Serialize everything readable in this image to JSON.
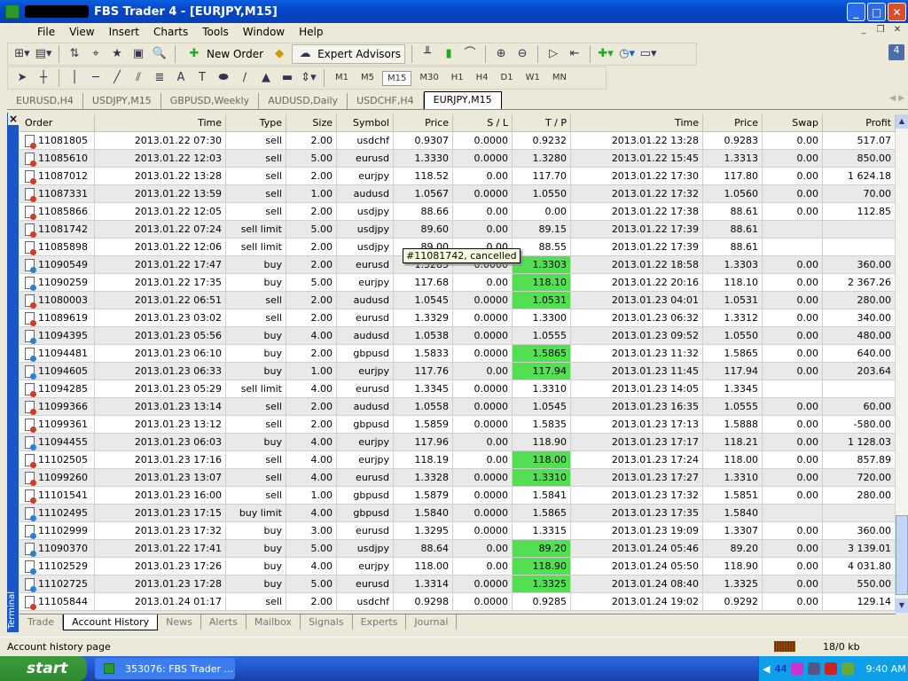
{
  "window": {
    "title": "FBS Trader 4 - [EURJPY,M15]",
    "minimize": "_",
    "maximize": "□",
    "close": "✕"
  },
  "menu": [
    "File",
    "View",
    "Insert",
    "Charts",
    "Tools",
    "Window",
    "Help"
  ],
  "toolbar": {
    "new_order": "New Order",
    "expert_advisors": "Expert Advisors",
    "badge": "4"
  },
  "timeframes": [
    "M1",
    "M5",
    "M15",
    "M30",
    "H1",
    "H4",
    "D1",
    "W1",
    "MN"
  ],
  "active_timeframe": "M15",
  "chart_tabs": [
    "EURUSD,H4",
    "USDJPY,M15",
    "GBPUSD,Weekly",
    "AUDUSD,Daily",
    "USDCHF,H4",
    "EURJPY,M15"
  ],
  "active_chart_tab": "EURJPY,M15",
  "terminal": {
    "label": "Terminal",
    "close": "×",
    "columns": [
      "Order",
      "Time",
      "Type",
      "Size",
      "Symbol",
      "Price",
      "S / L",
      "T / P",
      "Time",
      "Price",
      "Swap",
      "Profit"
    ],
    "sort_indicator": "/",
    "rows": [
      [
        "11081805",
        "2013.01.22 07:30",
        "sell",
        "2.00",
        "usdchf",
        "0.9307",
        "0.0000",
        "0.9232",
        "2013.01.22 13:28",
        "0.9283",
        "0.00",
        "517.07",
        false
      ],
      [
        "11085610",
        "2013.01.22 12:03",
        "sell",
        "5.00",
        "eurusd",
        "1.3330",
        "0.0000",
        "1.3280",
        "2013.01.22 15:45",
        "1.3313",
        "0.00",
        "850.00",
        false
      ],
      [
        "11087012",
        "2013.01.22 13:28",
        "sell",
        "2.00",
        "eurjpy",
        "118.52",
        "0.00",
        "117.70",
        "2013.01.22 17:30",
        "117.80",
        "0.00",
        "1 624.18",
        false
      ],
      [
        "11087331",
        "2013.01.22 13:59",
        "sell",
        "1.00",
        "audusd",
        "1.0567",
        "0.0000",
        "1.0550",
        "2013.01.22 17:32",
        "1.0560",
        "0.00",
        "70.00",
        false
      ],
      [
        "11085866",
        "2013.01.22 12:05",
        "sell",
        "2.00",
        "usdjpy",
        "88.66",
        "0.00",
        "0.00",
        "2013.01.22 17:38",
        "88.61",
        "0.00",
        "112.85",
        false
      ],
      [
        "11081742",
        "2013.01.22 07:24",
        "sell limit",
        "5.00",
        "usdjpy",
        "89.60",
        "0.00",
        "89.15",
        "2013.01.22 17:39",
        "88.61",
        "",
        "",
        false
      ],
      [
        "11085898",
        "2013.01.22 12:06",
        "sell limit",
        "2.00",
        "usdjpy",
        "89.00",
        "0.00",
        "88.55",
        "2013.01.22 17:39",
        "88.61",
        "",
        "",
        false
      ],
      [
        "11090549",
        "2013.01.22 17:47",
        "buy",
        "2.00",
        "eurusd",
        "1.3285",
        "0.0000",
        "1.3303",
        "2013.01.22 18:58",
        "1.3303",
        "0.00",
        "360.00",
        true
      ],
      [
        "11090259",
        "2013.01.22 17:35",
        "buy",
        "5.00",
        "eurjpy",
        "117.68",
        "0.00",
        "118.10",
        "2013.01.22 20:16",
        "118.10",
        "0.00",
        "2 367.26",
        true
      ],
      [
        "11080003",
        "2013.01.22 06:51",
        "sell",
        "2.00",
        "audusd",
        "1.0545",
        "0.0000",
        "1.0531",
        "2013.01.23 04:01",
        "1.0531",
        "0.00",
        "280.00",
        true
      ],
      [
        "11089619",
        "2013.01.23 03:02",
        "sell",
        "2.00",
        "eurusd",
        "1.3329",
        "0.0000",
        "1.3300",
        "2013.01.23 06:32",
        "1.3312",
        "0.00",
        "340.00",
        false
      ],
      [
        "11094395",
        "2013.01.23 05:56",
        "buy",
        "4.00",
        "audusd",
        "1.0538",
        "0.0000",
        "1.0555",
        "2013.01.23 09:52",
        "1.0550",
        "0.00",
        "480.00",
        false
      ],
      [
        "11094481",
        "2013.01.23 06:10",
        "buy",
        "2.00",
        "gbpusd",
        "1.5833",
        "0.0000",
        "1.5865",
        "2013.01.23 11:32",
        "1.5865",
        "0.00",
        "640.00",
        true
      ],
      [
        "11094605",
        "2013.01.23 06:33",
        "buy",
        "1.00",
        "eurjpy",
        "117.76",
        "0.00",
        "117.94",
        "2013.01.23 11:45",
        "117.94",
        "0.00",
        "203.64",
        true
      ],
      [
        "11094285",
        "2013.01.23 05:29",
        "sell limit",
        "4.00",
        "eurusd",
        "1.3345",
        "0.0000",
        "1.3310",
        "2013.01.23 14:05",
        "1.3345",
        "",
        "",
        false
      ],
      [
        "11099366",
        "2013.01.23 13:14",
        "sell",
        "2.00",
        "audusd",
        "1.0558",
        "0.0000",
        "1.0545",
        "2013.01.23 16:35",
        "1.0555",
        "0.00",
        "60.00",
        false
      ],
      [
        "11099361",
        "2013.01.23 13:12",
        "sell",
        "2.00",
        "gbpusd",
        "1.5859",
        "0.0000",
        "1.5835",
        "2013.01.23 17:13",
        "1.5888",
        "0.00",
        "-580.00",
        false
      ],
      [
        "11094455",
        "2013.01.23 06:03",
        "buy",
        "4.00",
        "eurjpy",
        "117.96",
        "0.00",
        "118.90",
        "2013.01.23 17:17",
        "118.21",
        "0.00",
        "1 128.03",
        false
      ],
      [
        "11102505",
        "2013.01.23 17:16",
        "sell",
        "4.00",
        "eurjpy",
        "118.19",
        "0.00",
        "118.00",
        "2013.01.23 17:24",
        "118.00",
        "0.00",
        "857.89",
        true
      ],
      [
        "11099260",
        "2013.01.23 13:07",
        "sell",
        "4.00",
        "eurusd",
        "1.3328",
        "0.0000",
        "1.3310",
        "2013.01.23 17:27",
        "1.3310",
        "0.00",
        "720.00",
        true
      ],
      [
        "11101541",
        "2013.01.23 16:00",
        "sell",
        "1.00",
        "gbpusd",
        "1.5879",
        "0.0000",
        "1.5841",
        "2013.01.23 17:32",
        "1.5851",
        "0.00",
        "280.00",
        false
      ],
      [
        "11102495",
        "2013.01.23 17:15",
        "buy limit",
        "4.00",
        "gbpusd",
        "1.5840",
        "0.0000",
        "1.5865",
        "2013.01.23 17:35",
        "1.5840",
        "",
        "",
        false
      ],
      [
        "11102999",
        "2013.01.23 17:32",
        "buy",
        "3.00",
        "eurusd",
        "1.3295",
        "0.0000",
        "1.3315",
        "2013.01.23 19:09",
        "1.3307",
        "0.00",
        "360.00",
        false
      ],
      [
        "11090370",
        "2013.01.22 17:41",
        "buy",
        "5.00",
        "usdjpy",
        "88.64",
        "0.00",
        "89.20",
        "2013.01.24 05:46",
        "89.20",
        "0.00",
        "3 139.01",
        true
      ],
      [
        "11102529",
        "2013.01.23 17:26",
        "buy",
        "4.00",
        "eurjpy",
        "118.00",
        "0.00",
        "118.90",
        "2013.01.24 05:50",
        "118.90",
        "0.00",
        "4 031.80",
        true
      ],
      [
        "11102725",
        "2013.01.23 17:28",
        "buy",
        "5.00",
        "eurusd",
        "1.3314",
        "0.0000",
        "1.3325",
        "2013.01.24 08:40",
        "1.3325",
        "0.00",
        "550.00",
        true
      ],
      [
        "11105844",
        "2013.01.24 01:17",
        "sell",
        "2.00",
        "usdchf",
        "0.9298",
        "0.0000",
        "0.9285",
        "2013.01.24 19:02",
        "0.9292",
        "0.00",
        "129.14",
        false
      ]
    ],
    "tooltip": "#11081742, cancelled",
    "tabs": [
      "Trade",
      "Account History",
      "News",
      "Alerts",
      "Mailbox",
      "Signals",
      "Experts",
      "Journal"
    ],
    "active_tab": "Account History"
  },
  "status": {
    "text": "Account history page",
    "traffic": "18/0 kb"
  },
  "colors": {
    "tp_hit": "#52e052",
    "buy_icon": "#2a7fd8",
    "sell_icon": "#d83a1a"
  },
  "taskbar": {
    "start": "start",
    "task": "353076: FBS Trader ...",
    "tray_count": "44",
    "clock": "9:40 AM"
  }
}
